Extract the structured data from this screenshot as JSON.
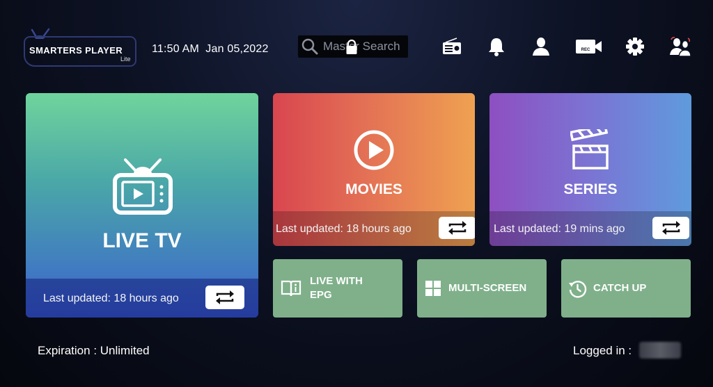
{
  "app": {
    "logo_text": "SMARTERS PLAYER",
    "logo_sub": "Lite"
  },
  "header": {
    "datetime": "11:50 AM  Jan 05,2022",
    "search_placeholder": "Master Search",
    "icons": [
      "radio-icon",
      "bell-icon",
      "user-icon",
      "rec-camera-icon",
      "gear-icon",
      "switch-user-icon"
    ],
    "rec_label": "REC"
  },
  "tiles": {
    "live_tv": {
      "title": "LIVE TV",
      "updated": "Last updated: 18 hours ago"
    },
    "movies": {
      "title": "MOVIES",
      "updated": "Last updated: 18 hours ago"
    },
    "series": {
      "title": "SERIES",
      "updated": "Last updated: 19 mins ago"
    }
  },
  "small_tiles": [
    {
      "label_line1": "LIVE WITH",
      "label_line2": "EPG"
    },
    {
      "label": "MULTI-SCREEN"
    },
    {
      "label": "CATCH UP"
    }
  ],
  "footer": {
    "expiration": "Expiration : Unlimited",
    "logged_in": "Logged in :"
  },
  "colors": {
    "small_tile": "#7fb08a",
    "background": "#0d1224"
  }
}
